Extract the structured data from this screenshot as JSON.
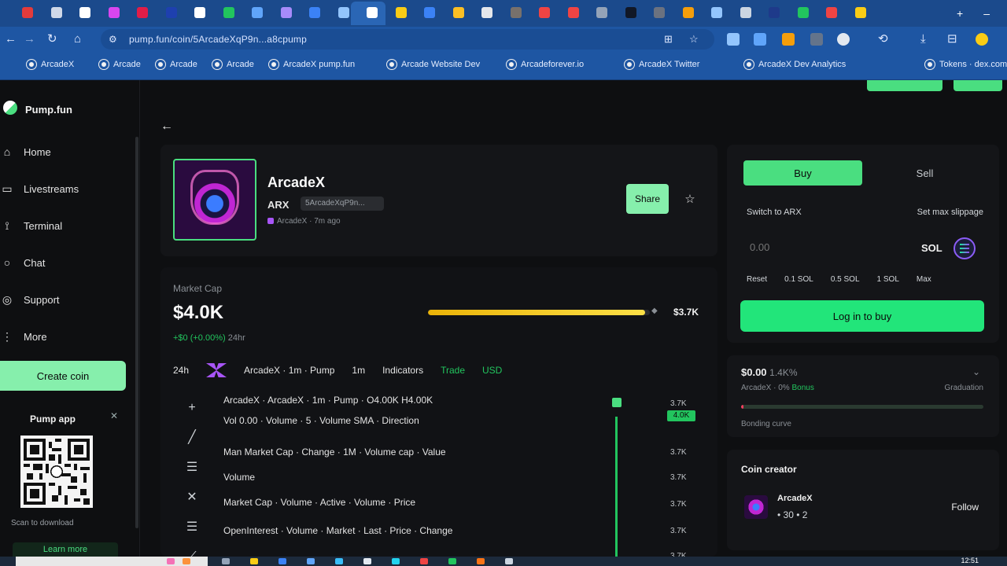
{
  "browser": {
    "url": "pump.fun/coin/5ArcadeXqP9n...a8cpump",
    "tab_colors": [
      "#e33b3b",
      "#cfd8e8",
      "#ffffff",
      "#d946ef",
      "#e11d48",
      "#1e40af",
      "#ffffff",
      "#22c55e",
      "#60a5fa",
      "#a78bfa",
      "#3b82f6",
      "#93c5fd",
      "#ffffff",
      "#facc15",
      "#3b82f6",
      "#fbbf24",
      "#e5e7eb",
      "#78716c",
      "#ef4444",
      "#ef4444",
      "#94a3b8",
      "#111827",
      "#6b7280",
      "#f59e0b",
      "#93c5fd",
      "#cbd5e1",
      "#1e3a8a",
      "#22c55e",
      "#ef4444",
      "#facc15"
    ],
    "window_buttons": [
      "+",
      "–",
      "□",
      "✕"
    ],
    "bookmarks": [
      "ArcadeX",
      "Arcade",
      "Arcade",
      "Arcade",
      "ArcadeX pump.fun",
      "Arcade Website Dev",
      "Arcadeforever.io",
      "ArcadeX Twitter",
      "ArcadeX Dev Analytics",
      "Tokens · dex.com"
    ]
  },
  "sidebar": {
    "brand": "Pump.fun",
    "items": [
      {
        "label": "Home",
        "icon": "home-icon",
        "glyph": "⌂"
      },
      {
        "label": "Livestreams",
        "icon": "video-icon",
        "glyph": "▭"
      },
      {
        "label": "Terminal",
        "icon": "terminal-icon",
        "glyph": "⟟"
      },
      {
        "label": "Chat",
        "icon": "chat-icon",
        "glyph": "○"
      },
      {
        "label": "Support",
        "icon": "support-icon",
        "glyph": "◎"
      },
      {
        "label": "More",
        "icon": "more-icon",
        "glyph": "⋮"
      }
    ],
    "create_button": "Create coin",
    "app_label": "Pump app",
    "qr_hint": "Scan to download",
    "learn_more": "Learn more"
  },
  "token": {
    "name": "ArcadeX",
    "ticker": "ARX",
    "address": "5ArcadeXqP9n...",
    "creator_line": "ArcadeX · 7m ago",
    "share_label": "Share",
    "star_glyph": "☆"
  },
  "market": {
    "label": "Market Cap",
    "value": "$4.0K",
    "change": "+$0 (+0.00%)",
    "change_period": "24hr",
    "ath_value": "$3.7K",
    "ath_progress": 0.98,
    "chart_toolbar": [
      "24h",
      "ArcadeX · 1m · Pump",
      "1m",
      "Indicators",
      "Trade",
      "USD"
    ],
    "ohlc_lines": [
      "ArcadeX · ArcadeX · 1m · Pump · O4.00K H4.00K",
      "Vol 0.00 · Volume · 5 · Volume SMA · Direction",
      "Man Market Cap · Change · 1M · Volume cap · Value",
      "Volume",
      "Market Cap · Volume · Active · Volume · Price",
      "OpenInterest · Volume · Market · Last · Price · Change"
    ],
    "axis_ticks": [
      "3.7K",
      "3.7K",
      "3.7K",
      "3.7K",
      "3.7K",
      "3.7K"
    ],
    "price_tag": "4.0K",
    "tool_glyphs": [
      "+",
      "╱",
      "☰",
      "✕",
      "☰",
      "⟋"
    ]
  },
  "trade": {
    "buy_label": "Buy",
    "sell_label": "Sell",
    "switch_label": "Switch to ARX",
    "slippage_label": "Set max slippage",
    "amount_placeholder": "0.00",
    "currency": "SOL",
    "quick_amounts": [
      "Reset",
      "0.1 SOL",
      "0.5 SOL",
      "1 SOL",
      "Max"
    ],
    "login_button": "Log in to buy"
  },
  "bonding": {
    "value": "$0.00",
    "value_sub": "1.4K%",
    "sub_left": "ArcadeX · 0%",
    "sub_left_green": "Bonus",
    "sub_right": "Graduation",
    "progress": 0.01,
    "footer": "Bonding curve",
    "caret": "⌄"
  },
  "creator": {
    "title": "Coin creator",
    "name": "ArcadeX",
    "stats": "• 30  • 2",
    "follow": "Follow"
  },
  "taskbar": {
    "clock": "12:51"
  }
}
